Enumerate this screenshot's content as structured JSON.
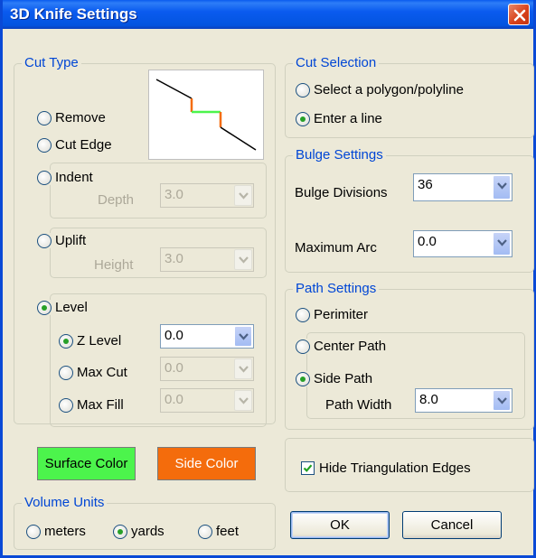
{
  "window": {
    "title": "3D Knife Settings"
  },
  "cut_type": {
    "legend": "Cut Type",
    "remove": "Remove",
    "cut_edge": "Cut Edge",
    "indent": "Indent",
    "depth_label": "Depth",
    "depth_value": "3.0",
    "uplift": "Uplift",
    "height_label": "Height",
    "height_value": "3.0",
    "level": "Level",
    "z_level": "Z Level",
    "z_level_value": "0.0",
    "max_cut": "Max Cut",
    "max_cut_value": "0.0",
    "max_fill": "Max Fill",
    "max_fill_value": "0.0",
    "selected": "Level",
    "level_selected": "Z Level"
  },
  "surface_color": {
    "label": "Surface Color",
    "color": "#4cf44c"
  },
  "side_color": {
    "label": "Side Color",
    "color": "#f46c0c"
  },
  "volume_units": {
    "legend": "Volume Units",
    "meters": "meters",
    "yards": "yards",
    "feet": "feet",
    "selected": "yards"
  },
  "cut_selection": {
    "legend": "Cut Selection",
    "polygon": "Select a polygon/polyline",
    "line": "Enter a line",
    "selected": "Enter a line"
  },
  "bulge_settings": {
    "legend": "Bulge Settings",
    "divisions_label": "Bulge Divisions",
    "divisions_value": "36",
    "max_arc_label": "Maximum Arc",
    "max_arc_value": "0.0"
  },
  "path_settings": {
    "legend": "Path Settings",
    "perimeter": "Perimiter",
    "center_path": "Center Path",
    "side_path": "Side Path",
    "path_width_label": "Path Width",
    "path_width_value": "8.0",
    "selected": "Side Path"
  },
  "hide_edges": {
    "label": "Hide Triangulation Edges",
    "checked": true
  },
  "buttons": {
    "ok": "OK",
    "cancel": "Cancel"
  },
  "icons": {
    "close": "close-icon",
    "dropdown": "chevron-down-icon",
    "check": "checkmark-icon"
  }
}
